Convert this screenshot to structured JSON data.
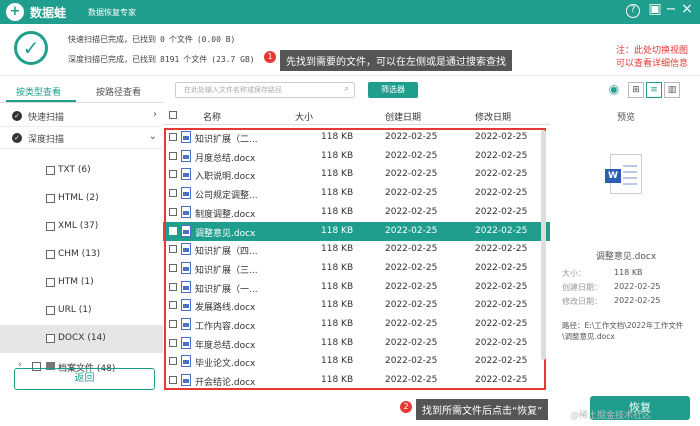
{
  "app": {
    "name": "数据蛙",
    "subtitle": "数据恢复专家",
    "help": "?",
    "save": "▣",
    "minimize": "−",
    "close": "×"
  },
  "status": {
    "quick": {
      "label": "快速扫描已完成，已找到",
      "count": "0",
      "unit": "个文件",
      "size": "(0.00  B)"
    },
    "deep": {
      "label": "深度扫描已完成，已找到",
      "count": "8191",
      "unit": "个文件",
      "size": "(23.7 GB)"
    }
  },
  "annotations": {
    "tip1_num": "1",
    "tip1": "先找到需要的文件，可以在左侧或是通过搜索查找",
    "tip2_num": "2",
    "tip2": "找到所需文件后点击“恢复”",
    "note_line1": "注：此处切换视图",
    "note_line2": "可以查看详细信息"
  },
  "sidebar": {
    "tab_type": "按类型查看",
    "tab_path": "按路径查看",
    "quick_scan": "快速扫描",
    "deep_scan": "深度扫描",
    "types": [
      {
        "label": "TXT (6)"
      },
      {
        "label": "HTML (2)"
      },
      {
        "label": "XML (37)"
      },
      {
        "label": "CHM (13)"
      },
      {
        "label": "HTM (1)"
      },
      {
        "label": "URL (1)"
      },
      {
        "label": "DOCX (14)"
      }
    ],
    "archive": "档案文件 (48)",
    "back": "返回"
  },
  "toolbar": {
    "search_placeholder": "在此处输入文件名称或保存路径",
    "filter": "筛选器"
  },
  "table": {
    "headers": {
      "name": "名称",
      "size": "大小",
      "created": "创建日期",
      "modified": "修改日期"
    },
    "rows": [
      {
        "name": "知识扩展（二...",
        "size": "118 KB",
        "created": "2022-02-25",
        "modified": "2022-02-25"
      },
      {
        "name": "月度总结.docx",
        "size": "118 KB",
        "created": "2022-02-25",
        "modified": "2022-02-25"
      },
      {
        "name": "入职说明.docx",
        "size": "118 KB",
        "created": "2022-02-25",
        "modified": "2022-02-25"
      },
      {
        "name": "公司规定调整...",
        "size": "118 KB",
        "created": "2022-02-25",
        "modified": "2022-02-25"
      },
      {
        "name": "制度调整.docx",
        "size": "118 KB",
        "created": "2022-02-25",
        "modified": "2022-02-25"
      },
      {
        "name": "调整意见.docx",
        "size": "118 KB",
        "created": "2022-02-25",
        "modified": "2022-02-25"
      },
      {
        "name": "知识扩展（四...",
        "size": "118 KB",
        "created": "2022-02-25",
        "modified": "2022-02-25"
      },
      {
        "name": "知识扩展（三...",
        "size": "118 KB",
        "created": "2022-02-25",
        "modified": "2022-02-25"
      },
      {
        "name": "知识扩展（一...",
        "size": "118 KB",
        "created": "2022-02-25",
        "modified": "2022-02-25"
      },
      {
        "name": "发展路线.docx",
        "size": "118 KB",
        "created": "2022-02-25",
        "modified": "2022-02-25"
      },
      {
        "name": "工作内容.docx",
        "size": "118 KB",
        "created": "2022-02-25",
        "modified": "2022-02-25"
      },
      {
        "name": "年度总结.docx",
        "size": "118 KB",
        "created": "2022-02-25",
        "modified": "2022-02-25"
      },
      {
        "name": "毕业论文.docx",
        "size": "118 KB",
        "created": "2022-02-25",
        "modified": "2022-02-25"
      },
      {
        "name": "开会结论.docx",
        "size": "118 KB",
        "created": "2022-02-25",
        "modified": "2022-02-25"
      }
    ]
  },
  "preview": {
    "title": "预览",
    "filename": "调整意见.docx",
    "doc_badge": "W",
    "size_label": "大小：",
    "size": "118 KB",
    "created_label": "创建日期：",
    "created": "2022-02-25",
    "modified_label": "修改日期：",
    "modified": "2022-02-25",
    "path_label": "路径：",
    "path": "E:\\工作文档\\2022年工作文件\\调整意见.docx"
  },
  "recover": "恢复",
  "watermark": "@稀土掘金技术社区"
}
